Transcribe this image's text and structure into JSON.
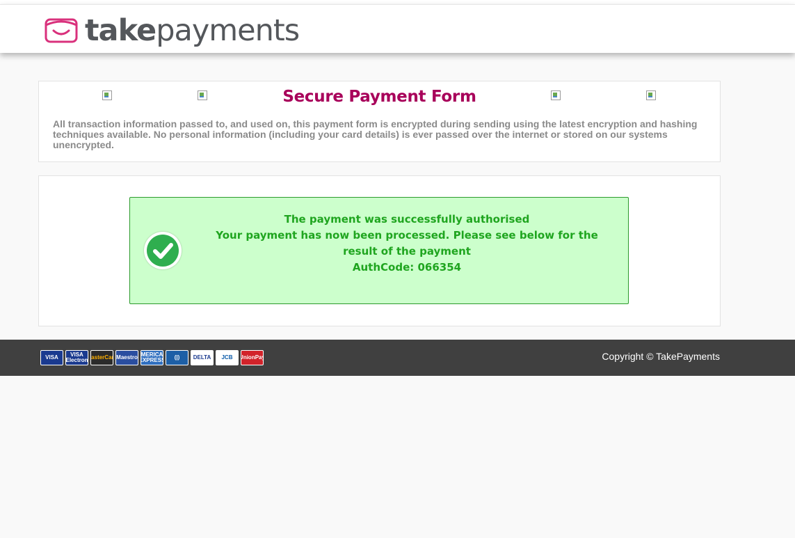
{
  "brand": {
    "name_bold": "take",
    "name_light": "payments"
  },
  "info_panel": {
    "title": "Secure Payment Form",
    "intro": "All transaction information passed to, and used on, this payment form is encrypted during sending using the latest encryption and hashing techniques available. No personal information (including your card details) is ever passed over the internet or stored on our systems unencrypted."
  },
  "result": {
    "line1": "The payment was successfully authorised",
    "line2": "Your payment has now been processed. Please see below for the result of the payment",
    "auth_code": "AuthCode: 066354",
    "icon": "check-circle-icon"
  },
  "footer": {
    "cards": [
      {
        "name": "visa-icon",
        "label": "VISA",
        "bg": "#1a3a8f",
        "fg": "#ffffff"
      },
      {
        "name": "visa-electron-icon",
        "label": "VISA Electron",
        "bg": "#1a3a8f",
        "fg": "#ffffff"
      },
      {
        "name": "mastercard-icon",
        "label": "MasterCard",
        "bg": "#2b2b2b",
        "fg": "#ffb000"
      },
      {
        "name": "maestro-icon",
        "label": "Maestro",
        "bg": "#2a4ea0",
        "fg": "#ffffff"
      },
      {
        "name": "american-express-icon",
        "label": "AMERICAN EXPRESS",
        "bg": "#2f6fc0",
        "fg": "#ffffff"
      },
      {
        "name": "diners-club-icon",
        "label": "(|)",
        "bg": "#1d5fa6",
        "fg": "#ffffff"
      },
      {
        "name": "visa-delta-icon",
        "label": "DELTA",
        "bg": "#ffffff",
        "fg": "#1a3a8f"
      },
      {
        "name": "jcb-icon",
        "label": "JCB",
        "bg": "#ffffff",
        "fg": "#0a5aa8"
      },
      {
        "name": "unionpay-icon",
        "label": "UnionPay",
        "bg": "#d2232a",
        "fg": "#ffffff"
      }
    ],
    "copyright": "Copyright © TakePayments"
  },
  "colors": {
    "brand_pink": "#d9317c",
    "title_magenta": "#a8005a",
    "success_green": "#1fa51f",
    "success_bg": "#ccffcc",
    "footer_bg": "#404040"
  }
}
